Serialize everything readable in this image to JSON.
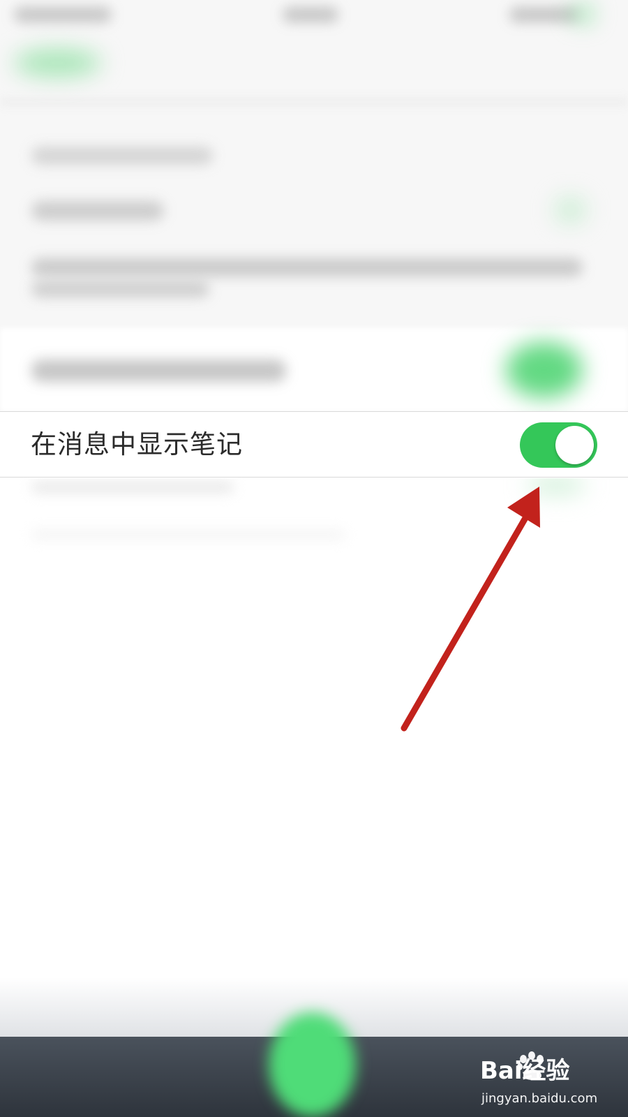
{
  "setting": {
    "label": "在消息中显示笔记",
    "toggle_on": true,
    "toggle_color": "#34c759"
  },
  "annotation": {
    "arrow_color": "#c2221c"
  },
  "watermark": {
    "brand_text": "Bai经验",
    "url": "jingyan.baidu.com"
  }
}
